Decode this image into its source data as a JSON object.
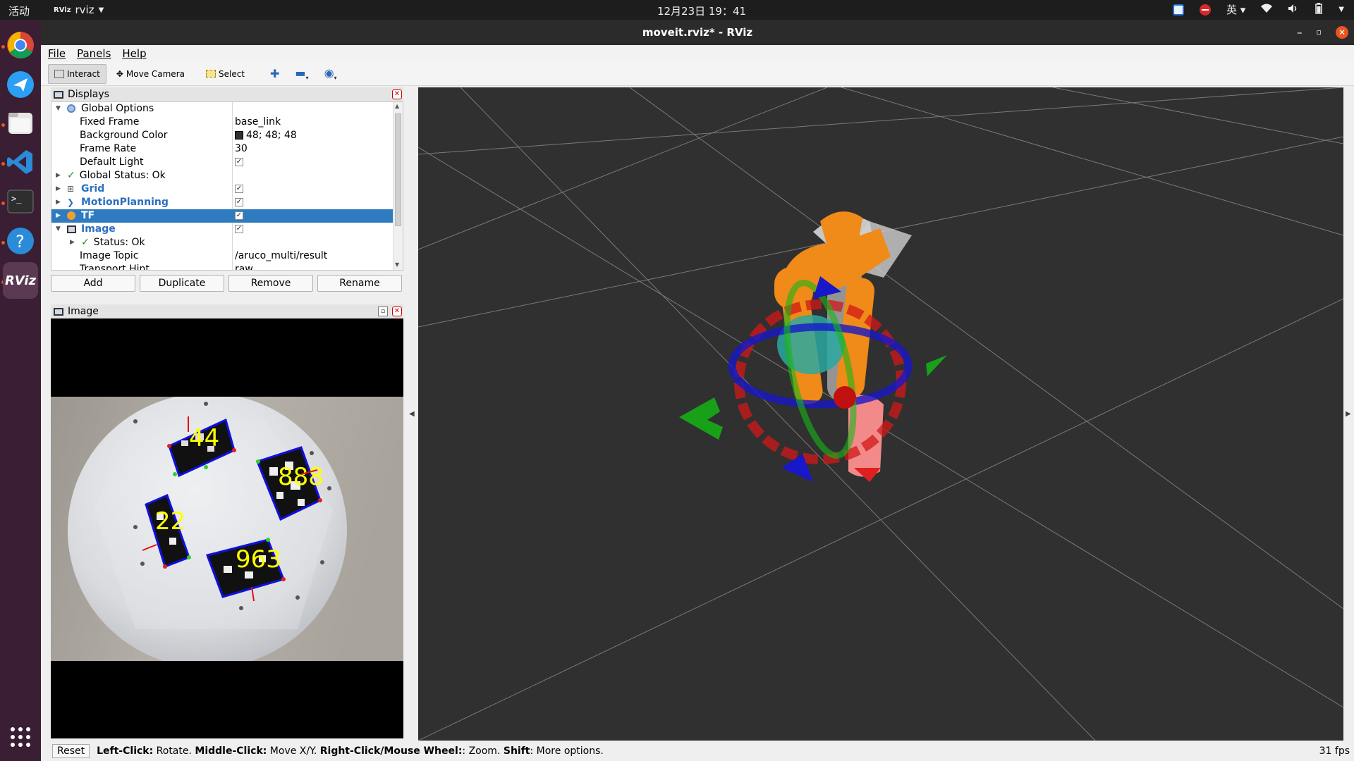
{
  "topbar": {
    "activities": "活动",
    "app_name": "rviz",
    "app_icon_text": "RViz",
    "clock": "12月23日  19：41",
    "input_method": "英"
  },
  "window": {
    "title": "moveit.rviz* - RViz"
  },
  "menu": {
    "file": "File",
    "panels": "Panels",
    "help": "Help"
  },
  "toolbar": {
    "interact": "Interact",
    "move_camera": "Move Camera",
    "select": "Select"
  },
  "displays": {
    "title": "Displays",
    "rows": {
      "global_options": "Global Options",
      "fixed_frame_key": "Fixed Frame",
      "fixed_frame_val": "base_link",
      "bg_color_key": "Background Color",
      "bg_color_val": "48; 48; 48",
      "frame_rate_key": "Frame Rate",
      "frame_rate_val": "30",
      "default_light_key": "Default Light",
      "global_status": "Global Status: Ok",
      "grid": "Grid",
      "motion_planning": "MotionPlanning",
      "tf": "TF",
      "image": "Image",
      "status_ok": "Status: Ok",
      "image_topic_key": "Image Topic",
      "image_topic_val": "/aruco_multi/result",
      "transport_hint_key": "Transport Hint",
      "transport_hint_val": "raw"
    },
    "buttons": {
      "add": "Add",
      "duplicate": "Duplicate",
      "remove": "Remove",
      "rename": "Rename"
    }
  },
  "image_panel": {
    "title": "Image",
    "marker_ids": [
      "44",
      "888",
      "22",
      "963"
    ]
  },
  "status": {
    "reset": "Reset",
    "left_click": "Left-Click:",
    "left_click_desc": " Rotate. ",
    "middle_click": "Middle-Click:",
    "middle_click_desc": " Move X/Y. ",
    "right_click": "Right-Click/Mouse Wheel:",
    "right_click_desc": ": Zoom. ",
    "shift": "Shift",
    "shift_desc": ": More options.",
    "fps": "31 fps"
  },
  "colors": {
    "accent_orange": "#e95420",
    "selection": "#2f7bbf",
    "view_bg": "#303030",
    "marker_text": "#ffff00"
  }
}
